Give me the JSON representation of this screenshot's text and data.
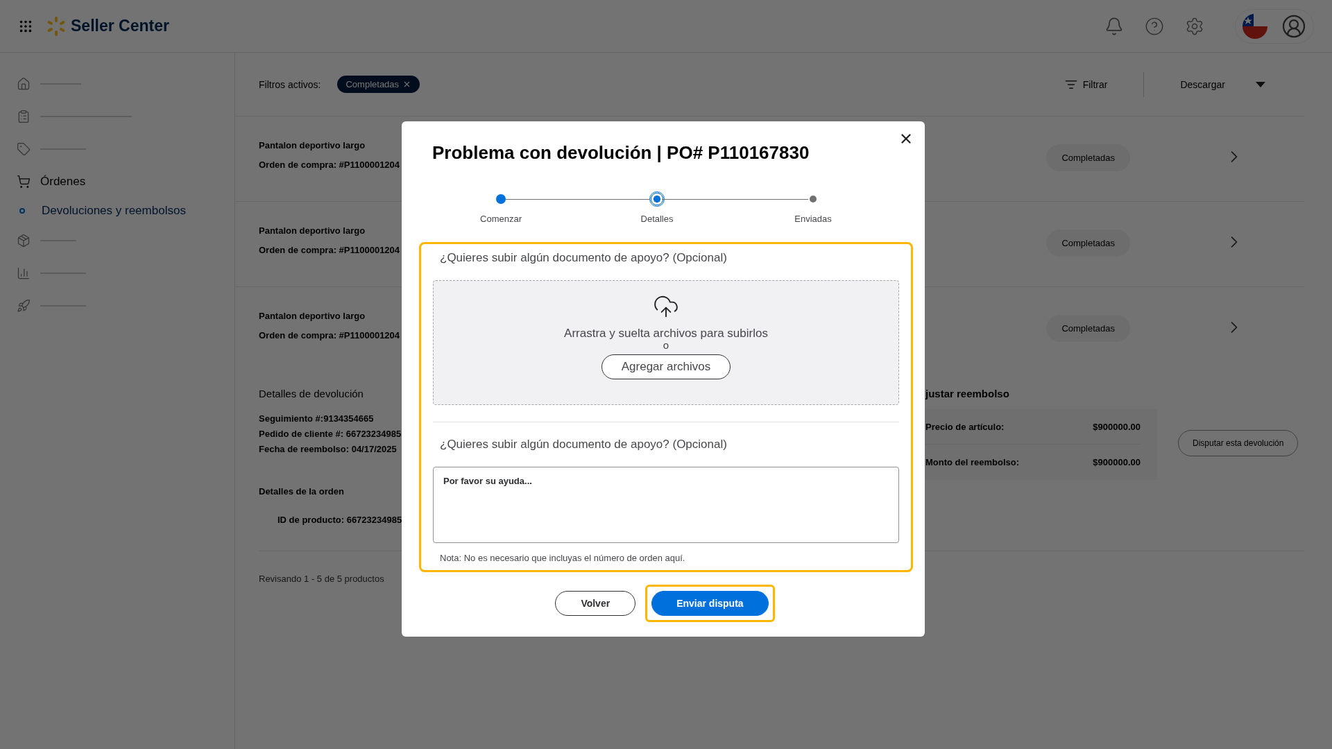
{
  "header": {
    "brand": "Seller Center"
  },
  "sidebar": {
    "items": [
      {
        "kind": "placeholder"
      },
      {
        "kind": "placeholder"
      },
      {
        "kind": "placeholder"
      },
      {
        "kind": "link",
        "label": "Órdenes",
        "selected": false,
        "children": [
          {
            "label": "Devoluciones y reembolsos",
            "selected": true
          }
        ]
      },
      {
        "kind": "placeholder"
      },
      {
        "kind": "placeholder"
      },
      {
        "kind": "placeholder"
      }
    ]
  },
  "filters": {
    "label": "Filtros activos:",
    "chips": [
      {
        "label": "Completadas"
      }
    ],
    "filter_button": "Filtrar",
    "download": "Descargar"
  },
  "orders": [
    {
      "name": "Pantalon deportivo largo",
      "po": "Orden de compra: #P1100001204",
      "status": "Completadas"
    },
    {
      "name": "Pantalon deportivo largo",
      "po": "Orden de compra: #P1100001204",
      "status": "Completadas"
    },
    {
      "name": "Pantalon deportivo largo",
      "po": "Orden de compra: #P1100001204",
      "status": "Completadas"
    }
  ],
  "return_details": {
    "title": "Detalles de devolución",
    "lines": [
      "Seguimiento #:9134354665",
      "Pedido de cliente #: 66723234985",
      "Fecha de reembolso: 04/17/2025"
    ],
    "order_title": "Detalles de la orden",
    "product_id": "ID de producto: 66723234985"
  },
  "refund": {
    "title": "justar reembolso",
    "rows": [
      {
        "label": "Precio de artículo:",
        "value": "$900000.00"
      },
      {
        "label": "Monto del reembolso:",
        "value": "$900000.00"
      }
    ],
    "dispute_button": "Disputar esta devolución"
  },
  "pagination": "Revisando 1 - 5 de 5 productos",
  "modal": {
    "title": "Problema con devolución | PO# P110167830",
    "steps": [
      {
        "label": "Comenzar",
        "done": true,
        "selected": false
      },
      {
        "label": "Detalles",
        "done": false,
        "selected": true
      },
      {
        "label": "Enviadas",
        "done": false,
        "selected": false
      }
    ],
    "highlighted": true,
    "upload": {
      "question": "¿Quieres subir algún documento de apoyo? (Opcional)",
      "hint": "Arrastra y suelta archivos para subirlos",
      "or": "o",
      "button": "Agregar archivos"
    },
    "comment": {
      "question": "¿Quieres subir algún documento de apoyo? (Opcional)",
      "placeholder": "Por favor su ayuda...",
      "note": "Nota: No es necesario que incluyas el número de orden aquí."
    },
    "buttons": [
      {
        "label": "Volver",
        "kind": "secondary",
        "highlighted": false
      },
      {
        "label": "Enviar disputa",
        "kind": "primary",
        "highlighted": true
      }
    ]
  }
}
